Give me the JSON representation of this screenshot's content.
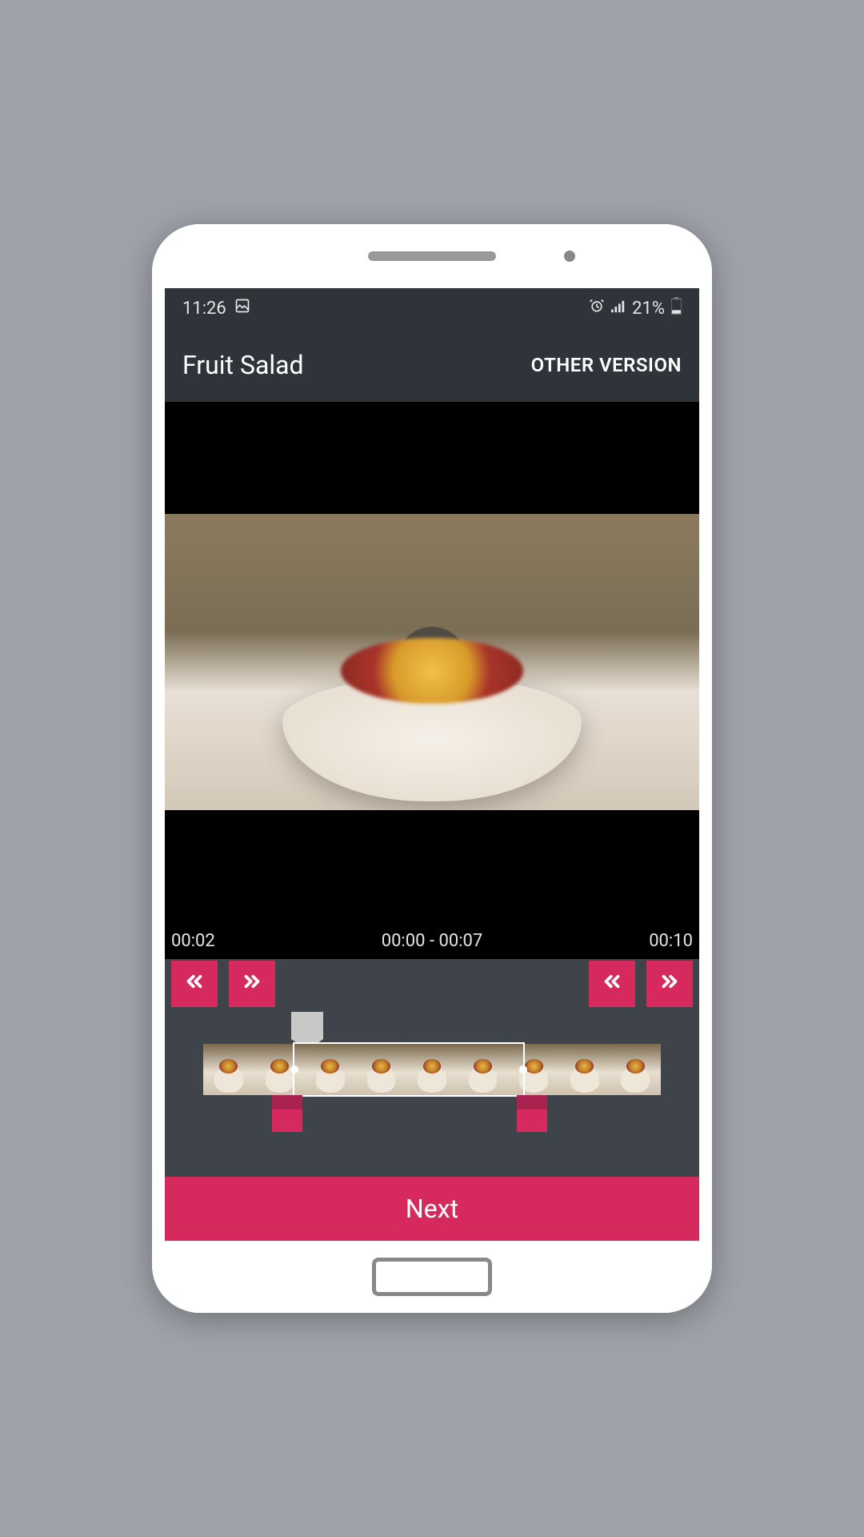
{
  "status": {
    "time": "11:26",
    "battery_text": "21%"
  },
  "header": {
    "title": "Fruit Salad",
    "action": "OTHER VERSION"
  },
  "player": {
    "current_time": "00:02",
    "range": "00:00 - 00:07",
    "total_time": "00:10"
  },
  "footer": {
    "next_label": "Next"
  }
}
